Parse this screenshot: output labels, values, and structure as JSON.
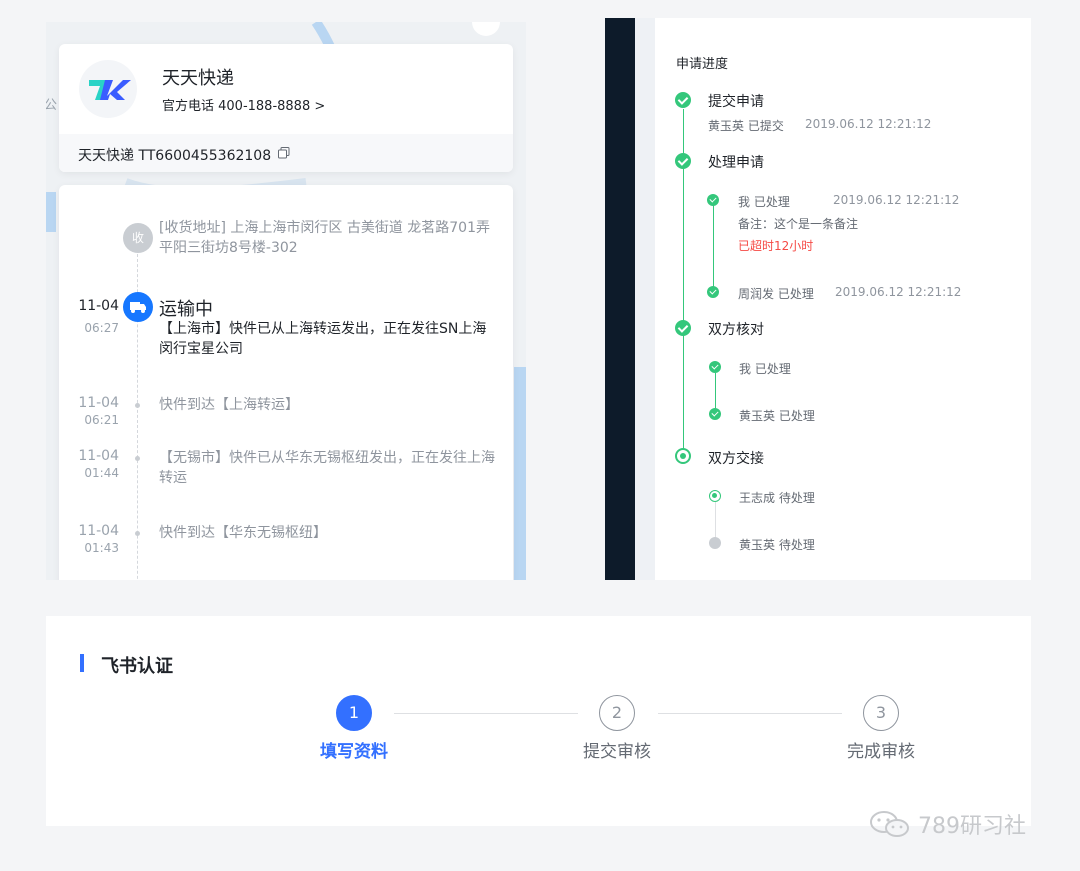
{
  "logistics": {
    "map_label": "公",
    "courier": {
      "name": "天天快递",
      "phone": "官方电话 400-188-8888 >",
      "track": "天天快递 TT6600455362108",
      "logo_colors": [
        "#29d3c6",
        "#3a5cff"
      ]
    },
    "timeline": {
      "receive_badge": "收",
      "receive_address": "[收货地址] 上海上海市闵行区  古美街道   龙茗路701弄平阳三街坊8号楼-302",
      "events": [
        {
          "date": "11-04",
          "time": "06:27",
          "status": "运输中",
          "text": "【上海市】快件已从上海转运发出，正在发往SN上海闵行宝星公司"
        },
        {
          "date": "11-04",
          "time": "06:21",
          "text": "快件到达【上海转运】"
        },
        {
          "date": "11-04",
          "time": "01:44",
          "text": "【无锡市】快件已从华东无锡枢纽发出，正在发往上海转运"
        },
        {
          "date": "11-04",
          "time": "01:43",
          "text": "快件到达【华东无锡枢纽】"
        }
      ]
    }
  },
  "progress": {
    "title": "申请进度",
    "steps": [
      {
        "name": "提交申请",
        "sub": "黄玉英 已提交",
        "date": "2019.06.12 12:21:12"
      },
      {
        "name": "处理申请",
        "items": [
          {
            "who": "我 已处理",
            "date": "2019.06.12 12:21:12",
            "note": "备注：这个是一条备注",
            "warning": "已超时12小时"
          },
          {
            "who": "周润发 已处理",
            "date": "2019.06.12 12:21:12"
          }
        ]
      },
      {
        "name": "双方核对",
        "items": [
          {
            "who": "我 已处理"
          },
          {
            "who": "黄玉英 已处理"
          }
        ]
      },
      {
        "name": "双方交接",
        "items": [
          {
            "who": "王志成 待处理"
          },
          {
            "who": "黄玉英 待处理"
          }
        ]
      }
    ],
    "colors": {
      "done": "#34c77b",
      "pending": "#c9cdd2",
      "warning": "#f54a45"
    }
  },
  "auth": {
    "title": "飞书认证",
    "steps": [
      {
        "number": "1",
        "label": "填写资料",
        "active": true
      },
      {
        "number": "2",
        "label": "提交审核",
        "active": false
      },
      {
        "number": "3",
        "label": "完成审核",
        "active": false
      }
    ],
    "accent": "#3370ff"
  },
  "watermark": "789研习社"
}
